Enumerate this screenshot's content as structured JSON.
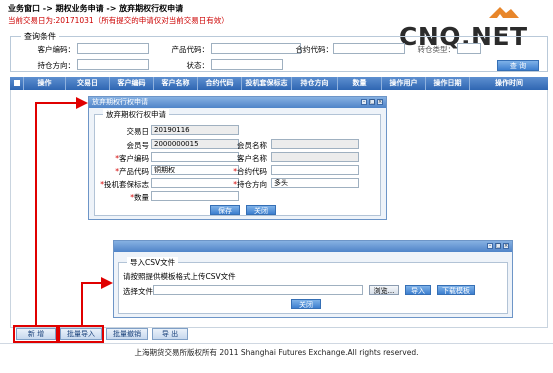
{
  "breadcrumb": "业务窗口 -> 期权业务申请 -> 放弃期权行权申请",
  "subtitle": "当前交易日为:20171031（所有提交的申请仅对当前交易日有效）",
  "watermark": {
    "text": "CNQ.NET"
  },
  "query": {
    "legend": "查询条件",
    "customer_code_label": "客户编码：",
    "product_code_label": "产品代码：",
    "contract_code_label": "合约代码：",
    "extra_label": "转仓类型：",
    "position_direction_label": "持仓方向：",
    "status_label": "状态：",
    "search_button": "查 询"
  },
  "table": {
    "headers": [
      "",
      "操作",
      "交易日",
      "客户编码",
      "客户名称",
      "合约代码",
      "投机套保标志",
      "持仓方向",
      "数量",
      "操作用户",
      "操作日期",
      "操作时间"
    ]
  },
  "dialog1": {
    "title": "放弃期权行权申请",
    "legend": "放弃期权行权申请",
    "trade_date_label": "交易日",
    "trade_date_value": "20190116",
    "member_no_label": "会员号",
    "member_no_value": "2000000015",
    "member_name_label": "会员名称",
    "customer_code_label": "客户编码",
    "customer_name_label": "客户名称",
    "product_code_label": "产品代码",
    "product_code_value": "铜期权",
    "contract_code_label": "合约代码",
    "hedge_flag_label": "投机套保标志",
    "position_direction_label": "持仓方向",
    "position_direction_value": "多头",
    "quantity_label": "数量",
    "save_button": "保存",
    "close_button": "关闭"
  },
  "dialog2": {
    "title": "",
    "legend": "导入CSV文件",
    "instruction": "请按照提供模板格式上传CSV文件",
    "file_label": "选择文件",
    "browse_button": "浏览...",
    "import_button": "导入",
    "download_template_button": "下载模板",
    "close_button": "关闭"
  },
  "bottom_buttons": {
    "new": "新 增",
    "batch_import": "批量导入",
    "batch_revoke": "批量撤销",
    "export": "导 出"
  },
  "footer": "上海期货交易所版权所有 2011 Shanghai Futures Exchange.All rights reserved.",
  "colors": {
    "header_blue": "#2f66b2",
    "dialog_border": "#6d95c7",
    "annotation_red": "#e00000",
    "subtitle_red": "#cc0000",
    "watermark_orange": "#e8862a"
  }
}
